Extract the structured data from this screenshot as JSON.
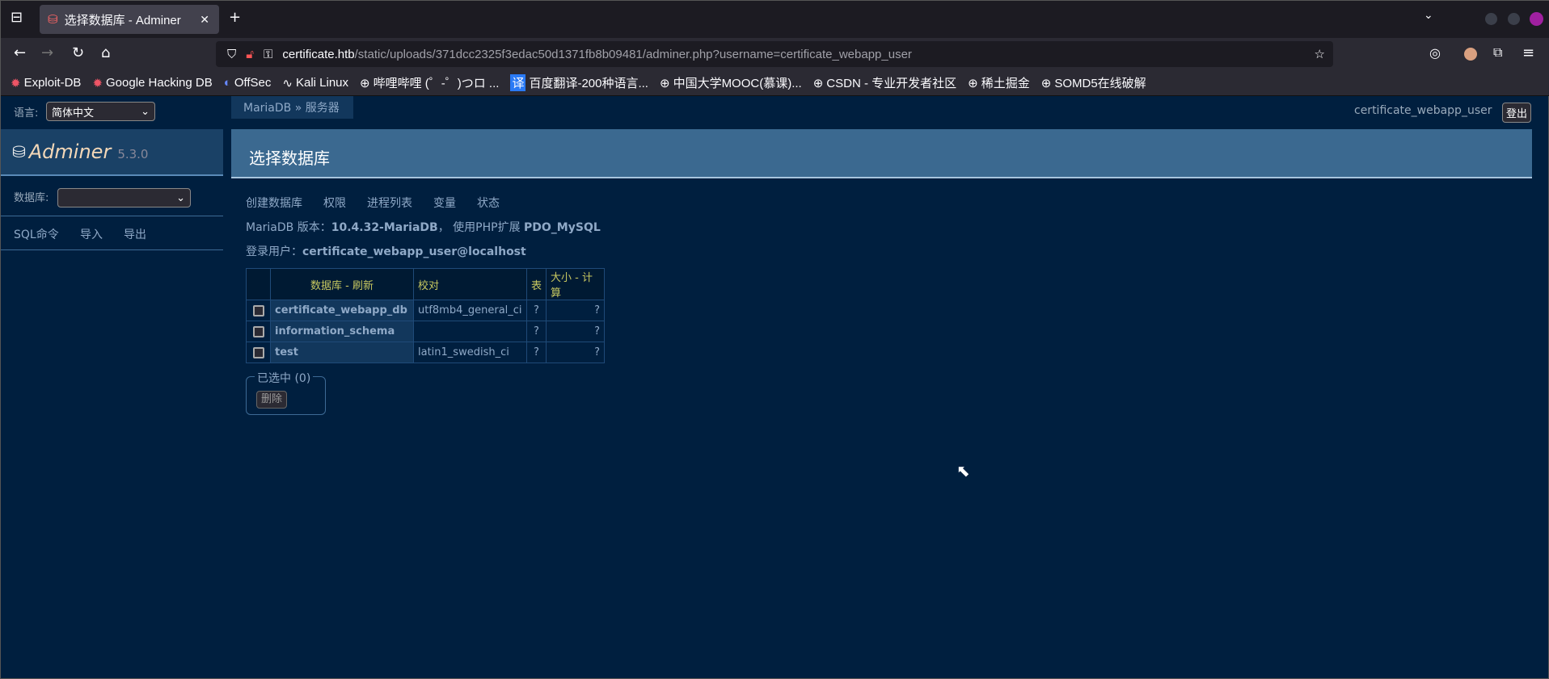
{
  "browser": {
    "tab_title": "选择数据库 - Adminer",
    "url_host": "certificate.htb",
    "url_path": "/static/uploads/371dcc2325f3edac50d1371fb8b09481/adminer.php?username=certificate_webapp_user",
    "bookmarks": [
      "Exploit-DB",
      "Google Hacking DB",
      "OffSec",
      "Kali Linux",
      "哔哩哔哩 (゜-゜)つロ ...",
      "百度翻译-200种语言...",
      "中国大学MOOC(慕课)...",
      "CSDN - 专业开发者社区",
      "稀土掘金",
      "SOMD5在线破解"
    ]
  },
  "sidebar": {
    "language_label": "语言:",
    "language_value": "简体中文",
    "app_name": "Adminer",
    "version": "5.3.0",
    "db_label": "数据库:",
    "db_value": "",
    "links": [
      "SQL命令",
      "导入",
      "导出"
    ]
  },
  "top": {
    "user": "certificate_webapp_user",
    "logout": "登出"
  },
  "breadcrumb": {
    "item1": "MariaDB",
    "sep": "»",
    "item2": "服务器"
  },
  "main": {
    "title": "选择数据库",
    "links": [
      "创建数据库",
      "权限",
      "进程列表",
      "变量",
      "状态"
    ],
    "version_prefix": "MariaDB 版本：",
    "version": "10.4.32-MariaDB",
    "ext_prefix": "， 使用PHP扩展 ",
    "ext": "PDO_MySQL",
    "login_prefix": "登录用户：",
    "login": "certificate_webapp_user@localhost",
    "table": {
      "headers": {
        "db": "数据库",
        "refresh": "刷新",
        "collation": "校对",
        "tables": "表",
        "size": "大小",
        "compute": "计算"
      },
      "rows": [
        {
          "name": "certificate_webapp_db",
          "collation": "utf8mb4_general_ci",
          "tables": "?",
          "size": "?"
        },
        {
          "name": "information_schema",
          "collation": "",
          "tables": "?",
          "size": "?"
        },
        {
          "name": "test",
          "collation": "latin1_swedish_ci",
          "tables": "?",
          "size": "?"
        }
      ]
    },
    "selected_label": "已选中 (0)",
    "delete": "删除"
  }
}
